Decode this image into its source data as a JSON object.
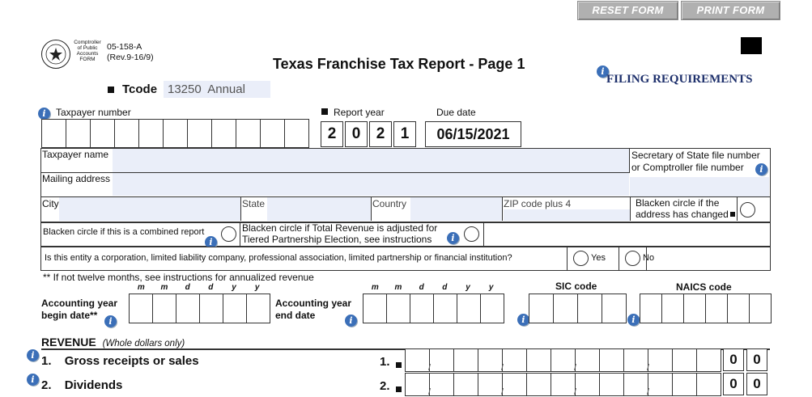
{
  "toolbar": {
    "reset": "RESET FORM",
    "print": "PRINT FORM"
  },
  "header": {
    "seal_text": "TEXAS",
    "agency": [
      "Comptroller",
      "of Public",
      "Accounts",
      "FORM"
    ],
    "form_number": "05-158-A",
    "revision": "(Rev.9-16/9)",
    "title": "Texas Franchise Tax Report - Page 1",
    "filing_requirements": "FILING REQUIREMENTS",
    "tcode_label": "Tcode",
    "tcode_value": "13250  Annual"
  },
  "fields": {
    "taxpayer_number": "Taxpayer number",
    "report_year": "Report year",
    "report_year_digits": [
      "2",
      "0",
      "2",
      "1"
    ],
    "due_date_label": "Due date",
    "due_date": "06/15/2021",
    "taxpayer_name": "Taxpayer name",
    "sos_file_line1": "Secretary of State file number",
    "sos_file_line2": "or Comptroller file number",
    "mailing_address": "Mailing address",
    "city": "City",
    "state": "State",
    "country": "Country",
    "zip": "ZIP code plus 4",
    "address_changed_line1": "Blacken circle if the",
    "address_changed_line2": "address has changed",
    "combined_report": "Blacken circle if this is a combined report",
    "tiered_line1": "Blacken circle if Total Revenue is adjusted for",
    "tiered_line2": "Tiered Partnership Election, see instructions",
    "entity_question": "Is this entity a corporation, limited liability company, professional association, limited partnership or financial institution?",
    "yes": "Yes",
    "no": "No",
    "twelve_months_note": "** If not twelve months, see instructions for annualized revenue",
    "date_format": [
      "m",
      "m",
      "d",
      "d",
      "y",
      "y"
    ],
    "acct_begin_line1": "Accounting year",
    "acct_begin_line2": "begin date**",
    "acct_end_line1": "Accounting  year",
    "acct_end_line2": "end date",
    "sic_code": "SIC code",
    "naics_code": "NAICS code"
  },
  "revenue": {
    "heading": "REVENUE",
    "subheading": "(Whole dollars only)",
    "lines": [
      {
        "num": "1.",
        "label": "Gross receipts or sales",
        "ref": "1.",
        "cents": [
          "0",
          "0"
        ]
      },
      {
        "num": "2.",
        "label": "Dividends",
        "ref": "2.",
        "cents": [
          "0",
          "0"
        ]
      }
    ]
  },
  "icons": {
    "info": "info-icon",
    "marker": "square-marker-icon",
    "seal": "texas-seal-icon",
    "barcode": "black-square-icon"
  },
  "colors": {
    "field_fill": "#eaeef9",
    "info_blue": "#3b6fb8",
    "button_gray": "#b0b0b0",
    "title_navy": "#1d2f6b"
  }
}
